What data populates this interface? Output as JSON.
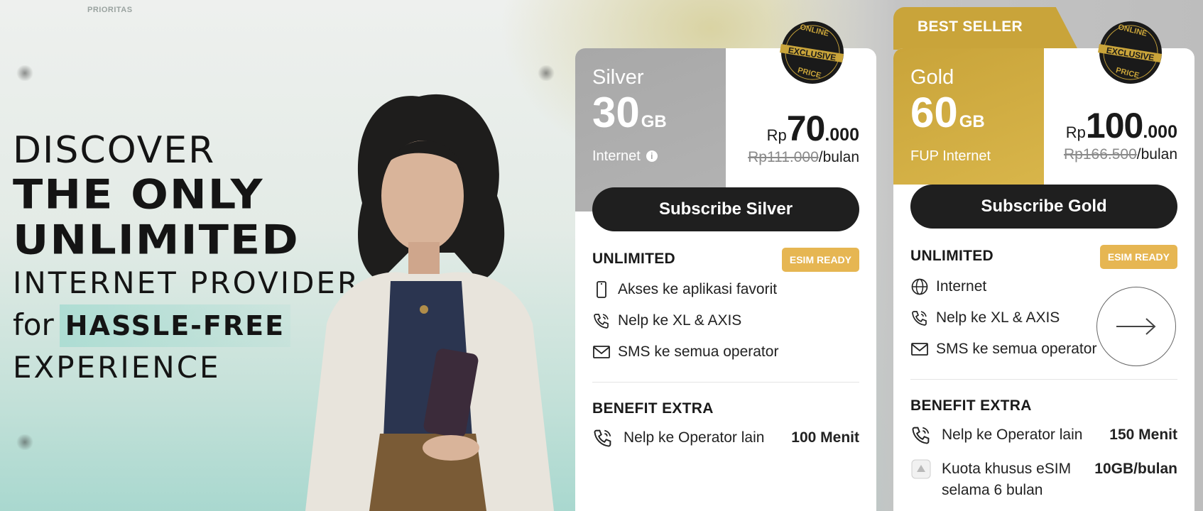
{
  "logo": {
    "text": "PRIORITAS"
  },
  "hero": {
    "line1": "DISCOVER",
    "line2": "THE ONLY",
    "line3": "UNLIMITED",
    "line4": "INTERNET PROVIDER",
    "line5_prefix": "for",
    "line5_highlight": "HASSLE-FREE",
    "line6": "EXPERIENCE"
  },
  "seal": {
    "top": "ONLINE",
    "middle": "EXCLUSIVE",
    "bottom": "PRICE"
  },
  "ribbon": {
    "label": "BEST SELLER"
  },
  "plans": [
    {
      "name": "Silver",
      "quota": "30",
      "quota_unit": "GB",
      "type": "Internet",
      "currency": "Rp",
      "price_big": "70",
      "price_small": ".000",
      "old_price": "Rp111.000",
      "period": "/bulan",
      "subscribe_label": "Subscribe Silver",
      "unlimited_title": "UNLIMITED",
      "esim_badge": "ESIM READY",
      "features": [
        "Akses ke aplikasi favorit",
        "Nelp ke XL & AXIS",
        "SMS ke semua operator"
      ],
      "benefit_title": "BENEFIT EXTRA",
      "benefits": [
        {
          "label": "Nelp ke Operator lain",
          "value": "100 Menit"
        }
      ]
    },
    {
      "name": "Gold",
      "quota": "60",
      "quota_unit": "GB",
      "type": "FUP Internet",
      "currency": "Rp",
      "price_big": "100",
      "price_small": ".000",
      "old_price": "Rp166.500",
      "period": "/bulan",
      "subscribe_label": "Subscribe Gold",
      "unlimited_title": "UNLIMITED",
      "esim_badge": "ESIM READY",
      "features": [
        "Internet",
        "Nelp ke XL & AXIS",
        "SMS ke semua operator"
      ],
      "benefit_title": "BENEFIT EXTRA",
      "benefits": [
        {
          "label": "Nelp ke Operator lain",
          "value": "150 Menit"
        },
        {
          "label": "Kuota khusus eSIM",
          "value": "10GB/bulan",
          "note": "selama 6 bulan"
        }
      ]
    }
  ],
  "colors": {
    "gold": "#c9a43a",
    "silver": "#a8a8a8",
    "badge": "#e6b652",
    "button": "#1f1f1f"
  },
  "icons": [
    "phone-icon",
    "globe-icon",
    "call-icon",
    "mail-icon",
    "esim-icon",
    "info-icon",
    "arrow-right-icon"
  ]
}
